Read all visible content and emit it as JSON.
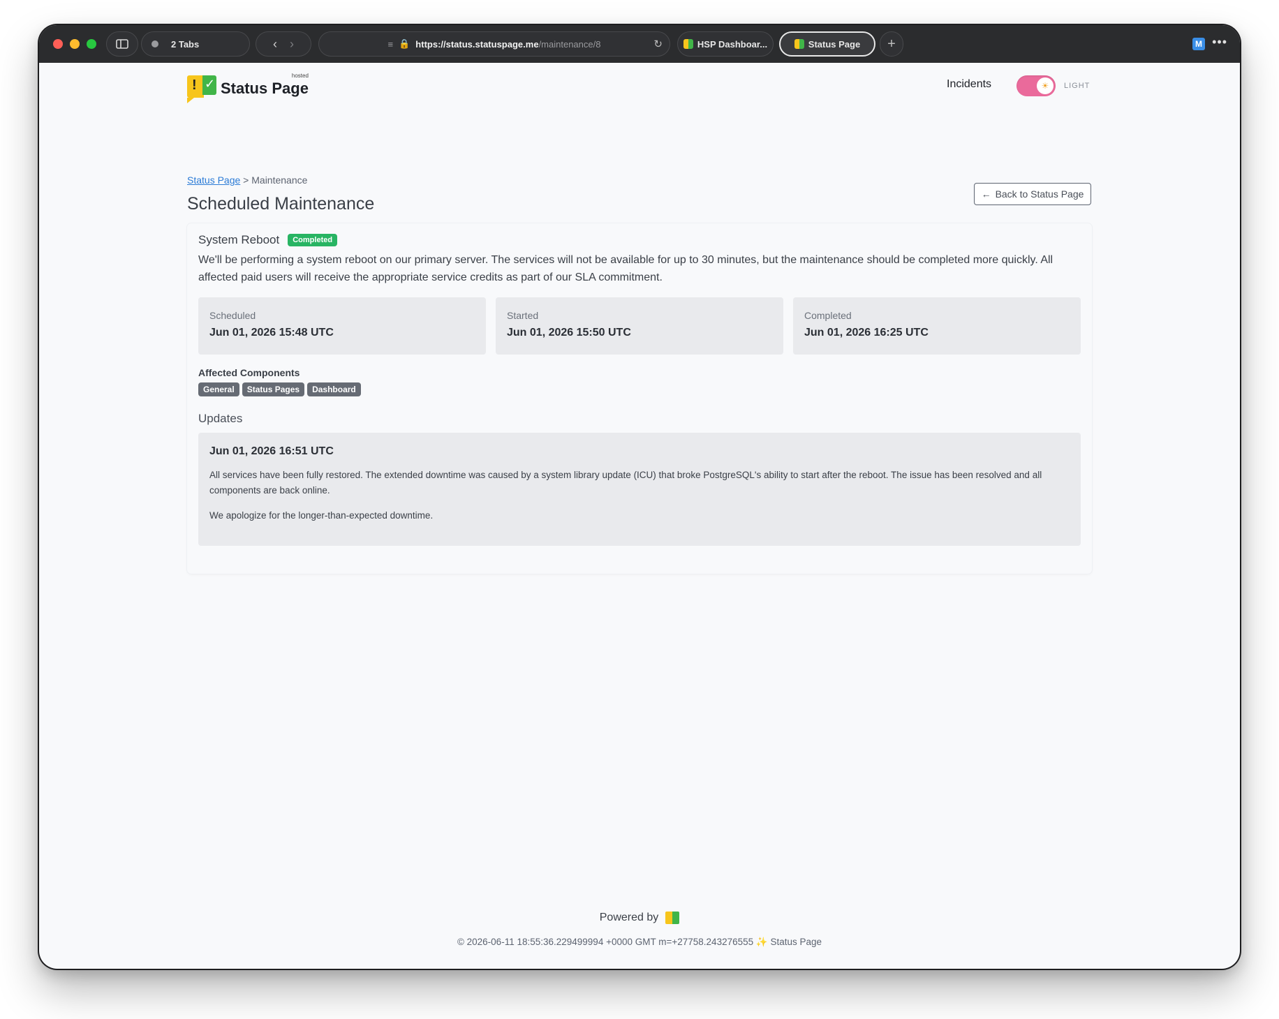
{
  "browser": {
    "tabs_count_label": "2 Tabs",
    "url_host": "https://status.statuspage.me",
    "url_path": "/maintenance/8",
    "tabs": [
      {
        "label": "HSP Dashboar...",
        "active": false
      },
      {
        "label": "Status Page",
        "active": true
      }
    ],
    "new_tab_symbol": "+",
    "extension_letter": "M",
    "more_symbol": "•••"
  },
  "header": {
    "brand": "Status Page",
    "brand_hosted": "hosted",
    "nav_incidents": "Incidents",
    "theme_label": "LIGHT",
    "theme_on": true
  },
  "breadcrumb": {
    "root": "Status Page",
    "separator": ">",
    "current": "Maintenance"
  },
  "page": {
    "title": "Scheduled Maintenance",
    "back_button": "Back to Status Page"
  },
  "maintenance": {
    "title": "System Reboot",
    "status": "Completed",
    "description": "We'll be performing a system reboot on our primary server. The services will not be available for up to 30 minutes, but the maintenance should be completed more quickly. All affected paid users will receive the appropriate service credits as part of our SLA commitment.",
    "times": [
      {
        "label": "Scheduled",
        "value": "Jun 01, 2026 15:48 UTC"
      },
      {
        "label": "Started",
        "value": "Jun 01, 2026 15:50 UTC"
      },
      {
        "label": "Completed",
        "value": "Jun 01, 2026 16:25 UTC"
      }
    ],
    "affected_title": "Affected Components",
    "components": [
      "General",
      "Status Pages",
      "Dashboard"
    ],
    "updates_title": "Updates",
    "updates": [
      {
        "date": "Jun 01, 2026 16:51 UTC",
        "paragraph_1": "All services have been fully restored. The extended downtime was caused by a system library update (ICU) that broke PostgreSQL's ability to start after the reboot. The issue has been resolved and all components are back online.",
        "paragraph_2": "We apologize for the longer-than-expected downtime."
      }
    ]
  },
  "footer": {
    "powered_by": "Powered by",
    "copyright": "© 2026-06-11 18:55:36.229499994 +0000 GMT m=+27758.243276555",
    "brand": "Status Page"
  },
  "colors": {
    "completed_badge": "#28b463",
    "chip": "#666b74",
    "toggle": "#ea6a9b",
    "link": "#2b7bd6"
  }
}
